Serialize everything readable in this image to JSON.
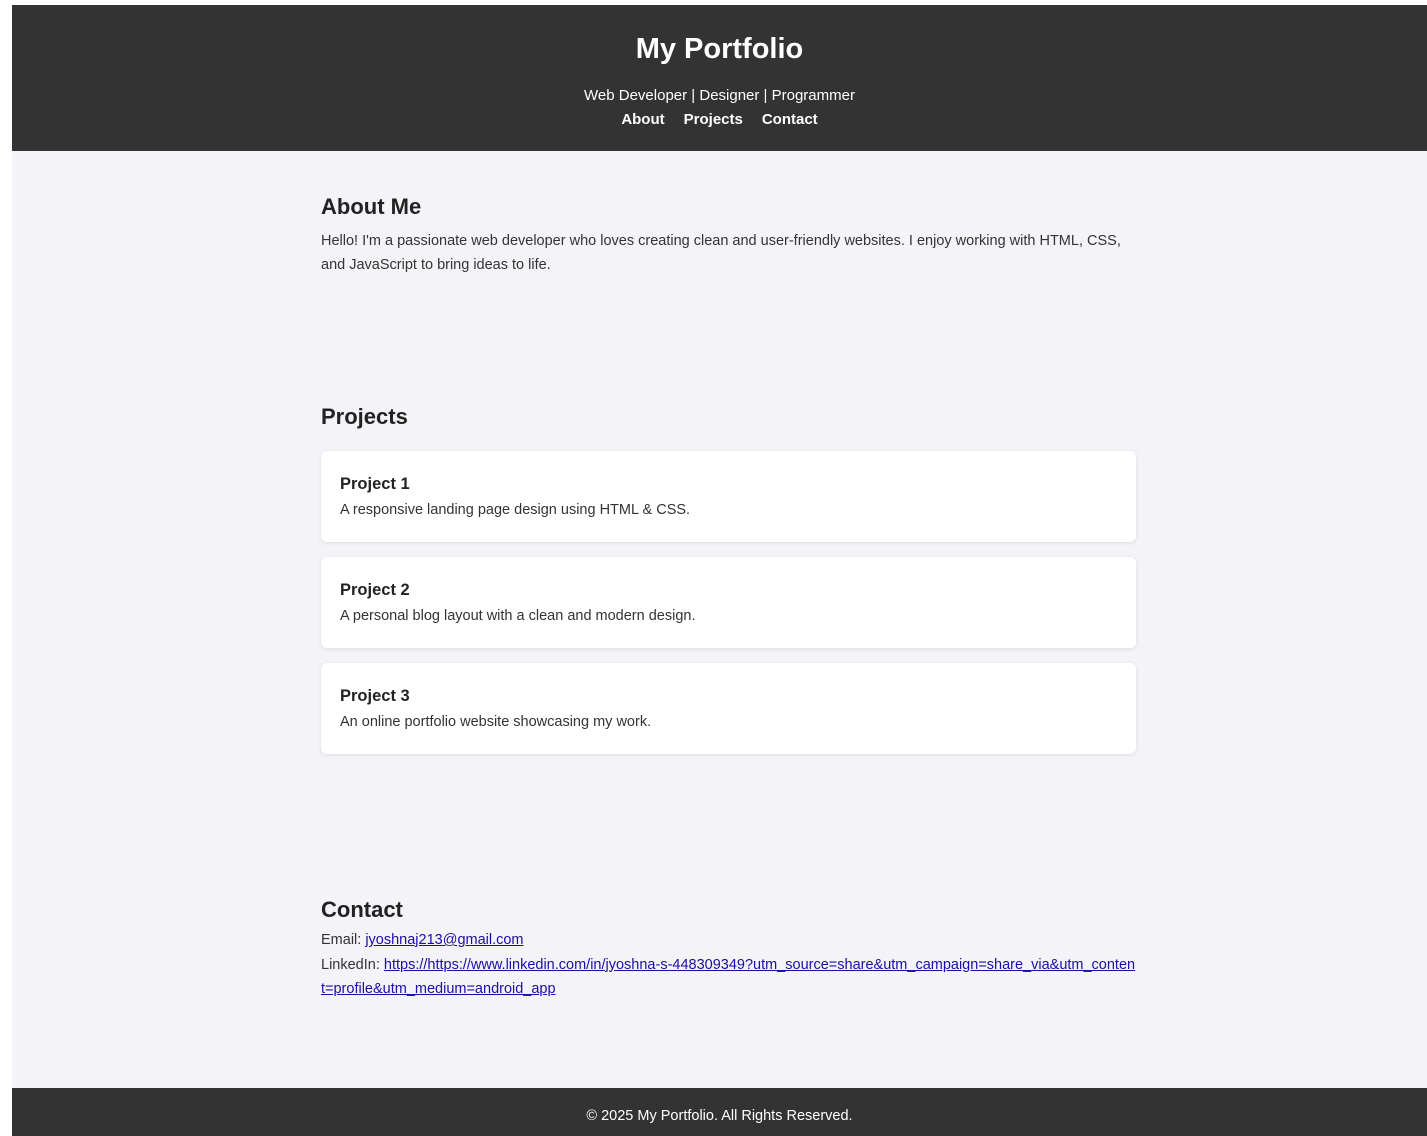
{
  "header": {
    "title": "My Portfolio",
    "tagline": "Web Developer | Designer | Programmer",
    "nav": [
      {
        "label": "About"
      },
      {
        "label": "Projects"
      },
      {
        "label": "Contact"
      }
    ]
  },
  "about": {
    "heading": "About Me",
    "text": "Hello! I'm a passionate web developer who loves creating clean and user-friendly websites. I enjoy working with HTML, CSS, and JavaScript to bring ideas to life."
  },
  "projects": {
    "heading": "Projects",
    "items": [
      {
        "name": "Project 1",
        "description": "A responsive landing page design using HTML & CSS."
      },
      {
        "name": "Project 2",
        "description": "A personal blog layout with a clean and modern design."
      },
      {
        "name": "Project 3",
        "description": "An online portfolio website showcasing my work."
      }
    ]
  },
  "contact": {
    "heading": "Contact",
    "email_label": "Email:",
    "email": "jyoshnaj213@gmail.com",
    "linkedin_label": "LinkedIn:",
    "linkedin_url": "https://https://www.linkedin.com/in/jyoshna-s-448309349?utm_source=share&utm_campaign=share_via&utm_content=profile&utm_medium=android_app"
  },
  "footer": {
    "text": "© 2025 My Portfolio. All Rights Reserved."
  },
  "colors": {
    "header_bg": "#333333",
    "page_bg": "#f4f4f8",
    "card_bg": "#ffffff",
    "link": "#1a0dab"
  }
}
